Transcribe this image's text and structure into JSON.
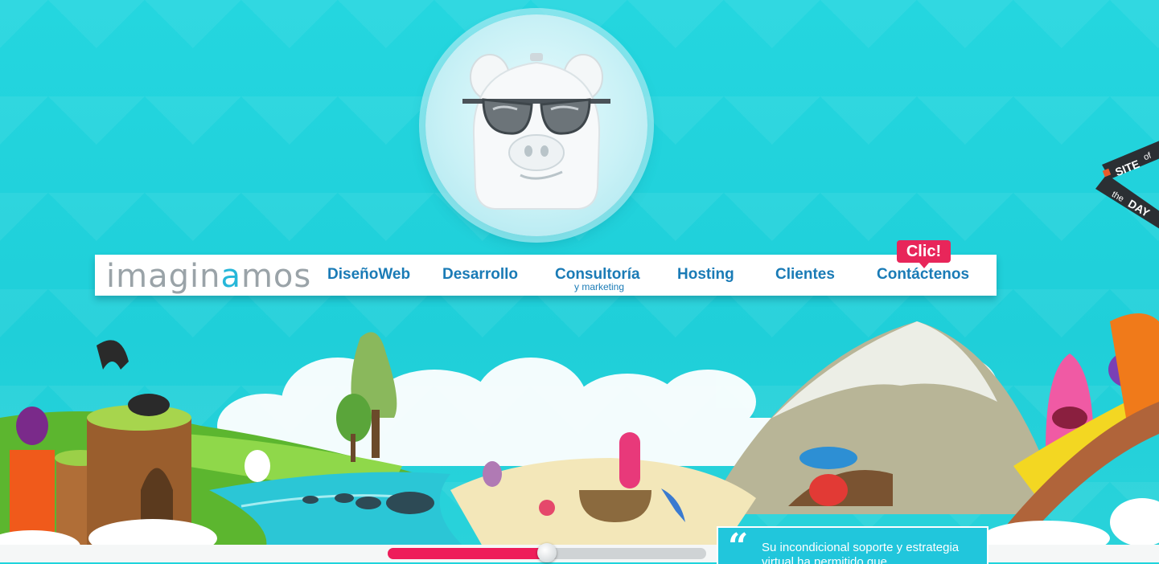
{
  "logo": {
    "part1": "imagin",
    "accent": "a",
    "part2": "mos"
  },
  "nav": {
    "items": [
      {
        "label": "DiseñoWeb"
      },
      {
        "label": "Desarrollo"
      },
      {
        "label": "Consultoría",
        "sub": "y marketing"
      },
      {
        "label": "Hosting"
      },
      {
        "label": "Clientes"
      },
      {
        "label": "Contáctenos",
        "badge": "Clic!"
      }
    ]
  },
  "award": {
    "line1": "SITE",
    "line2": "of",
    "line3": "the",
    "line4": "DAY"
  },
  "testimonial": {
    "quote_mark": "“",
    "text": "Su incondicional soporte y estrategia virtual ha permitido que"
  },
  "slider": {
    "progress": 0.5
  },
  "colors": {
    "sky": "#1fd4dc",
    "nav_text": "#1a7bb6",
    "badge": "#e8265a",
    "slider_fill": "#ee1d5a"
  }
}
